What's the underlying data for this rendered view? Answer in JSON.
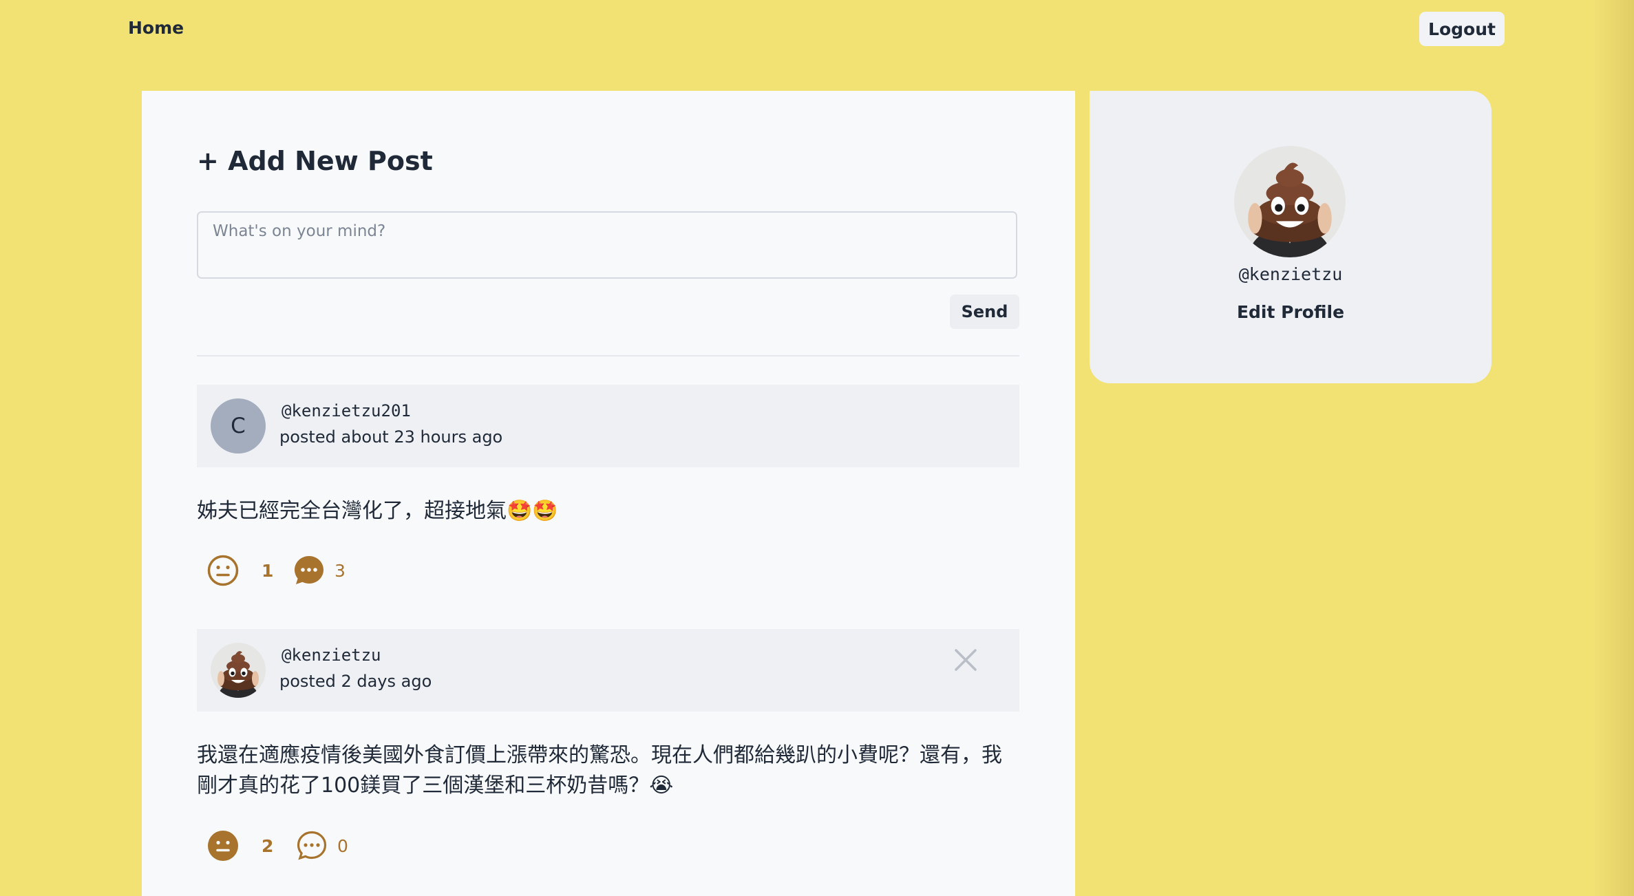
{
  "nav": {
    "home_label": "Home",
    "logout_label": "Logout"
  },
  "composer": {
    "title": "+ Add New Post",
    "placeholder": "What's on your mind?",
    "send_label": "Send"
  },
  "posts": [
    {
      "avatar_letter": "C",
      "username": "@kenzietzu201",
      "time": "posted about 23 hours ago",
      "body": "姊夫已經完全台灣化了，超接地氣🤩🤩",
      "reaction_count": "1",
      "comment_count": "3",
      "deletable": false
    },
    {
      "avatar_icon": "poop-emoji-avatar",
      "username": "@kenzietzu",
      "time": "posted 2 days ago",
      "body": "我還在適應疫情後美國外食訂價上漲帶來的驚恐。現在人們都給幾趴的小費呢？還有，我剛才真的花了100鎂買了三個漢堡和三杯奶昔嗎？😭",
      "reaction_count": "2",
      "comment_count": "0",
      "deletable": true
    }
  ],
  "profile": {
    "handle": "@kenzietzu",
    "edit_label": "Edit Profile"
  },
  "colors": {
    "background": "#f2e274",
    "accent": "#a8732c",
    "panel": "#f8f9fb",
    "card": "#eef0f4"
  }
}
